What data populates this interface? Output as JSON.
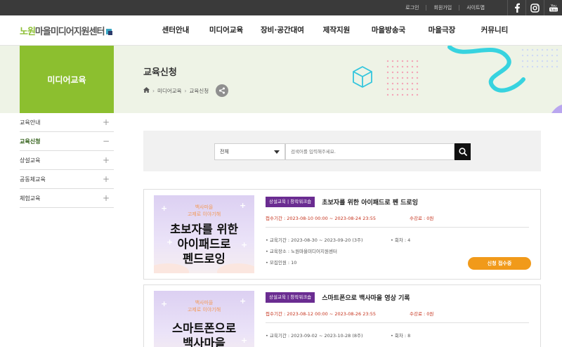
{
  "utility": {
    "links": [
      "로그인",
      "회원가입",
      "사이트맵"
    ]
  },
  "sns": [
    {
      "icon": "facebook-icon",
      "glyph": "f"
    },
    {
      "icon": "instagram-icon",
      "glyph": "◻"
    },
    {
      "icon": "youtube-icon",
      "glyph": "You Tube"
    }
  ],
  "logo": {
    "text_green": "노원",
    "text_rest": "마을미디어지원센터"
  },
  "gnb": [
    "센터안내",
    "미디어교육",
    "장비·공간대여",
    "제작지원",
    "마을방송국",
    "마을극장",
    "커뮤니티"
  ],
  "visual": {
    "section_title": "미디어교육",
    "page_title": "교육신청",
    "breadcrumb": [
      "미디어교육",
      "교육신청"
    ]
  },
  "lnb": [
    {
      "label": "교육안내",
      "state": "+"
    },
    {
      "label": "교육신청",
      "state": "−"
    },
    {
      "label": "상설교육",
      "state": "+"
    },
    {
      "label": "공동체교육",
      "state": "+"
    },
    {
      "label": "체험교육",
      "state": "+"
    }
  ],
  "search": {
    "select_value": "전체",
    "placeholder": "검색어를 입력해주세요."
  },
  "courses": [
    {
      "thumb_small_1": "백사마을",
      "thumb_small_2": "고제로 이야기해",
      "thumb_lines": [
        "초보자를 위한",
        "아이패드로",
        "펜드로잉"
      ],
      "badge": "상설교육 | 창작워크숍",
      "title": "초보자를 위한 아이패드로 펜 드로잉",
      "period": "접수기간 : 2023-08-10 00:00 ~ 2023-08-24 23:55",
      "count": "수강료 : 0원",
      "edu_period": "• 교육기간 : 2023-08-30 ~ 2023-09-20 (3주)",
      "sessions": "• 회차 : 4",
      "place": "• 교육장소 : 노원마을미디어지원센터",
      "capacity": "• 모집인원 : 10",
      "apply": "신청 접수중"
    },
    {
      "thumb_small_1": "백사마을",
      "thumb_small_2": "고제로 이야기해",
      "thumb_lines": [
        "스마트폰으로",
        "백사마을"
      ],
      "badge": "상설교육 | 창작워크숍",
      "title": "스마트폰으로 백사마을 영상 기록",
      "period": "접수기간 : 2023-08-12 00:00 ~ 2023-08-26 23:55",
      "count": "수강료 : 0원",
      "edu_period": "• 교육기간 : 2023-09-02 ~ 2023-10-28 (8주)",
      "sessions": "• 회차 : 8"
    }
  ]
}
